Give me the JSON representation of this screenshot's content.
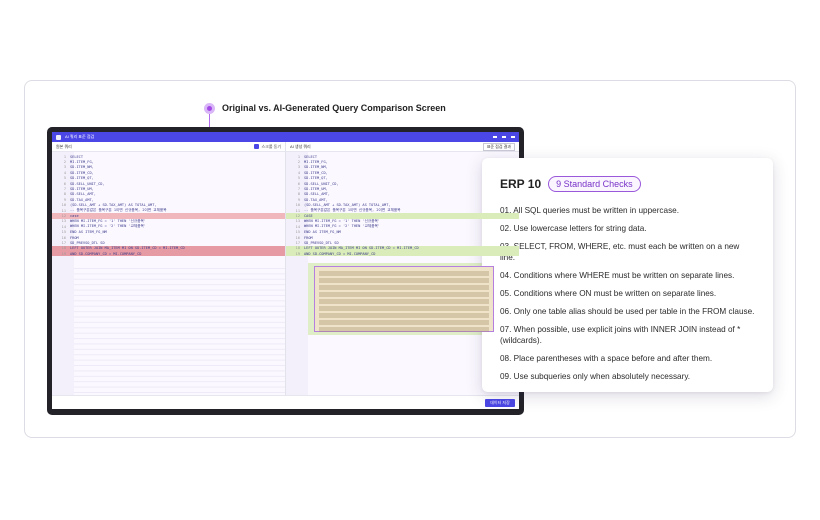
{
  "callout": {
    "label": "Original vs. AI-Generated Query Comparison Screen"
  },
  "window": {
    "title": "AI 쿼리 표준 점검",
    "footer_button": "데이터 저장"
  },
  "left_pane": {
    "header": "원본 쿼리",
    "checkbox_label": "스크롤 동기",
    "lines": [
      "SELECT",
      "  MI.ITEM_FG,",
      "  SD.ITEM_NM,",
      "  SD.ITEM_CD,",
      "  SD.ITEM_QT,",
      "  SD.SELL_UNIT_CD,",
      "  SD.ITEM_UM,",
      "  SD.SELL_AMT,",
      "  SD.TAX_AMT,",
      "  (SD.SELL_AMT + SD.TAX_AMT) AS TOTAL_AMT,",
      "  -- 품목구분값은 품목구분 1이면 신규품목, 2이면 교체품목",
      "  case",
      "    WHEN MI.ITEM_FG = '1' THEN '신규품목'",
      "    WHEN MI.ITEM_FG = '2' THEN '교체품목'",
      "  END AS ITEM_FG_NM",
      "FROM",
      "  SD_PREVSO_DTL SD",
      "  LEFT OUTER JOIN MA_ITEM MI ON SD.ITEM_CD = MI.ITEM_CD",
      "  AND SD.COMPANY_CD = MI.COMPANY_CD"
    ]
  },
  "right_pane": {
    "header": "AI 생성 쿼리",
    "button": "표준 점검 결과",
    "lines": [
      "SELECT",
      "  MI.ITEM_FG,",
      "  SD.ITEM_NM,",
      "  SD.ITEM_CD,",
      "  SD.ITEM_QT,",
      "  SD.SELL_UNIT_CD,",
      "  SD.ITEM_UM,",
      "  SD.SELL_AMT,",
      "  SD.TAX_AMT,",
      "  (SD.SELL_AMT + SD.TAX_AMT) AS TOTAL_AMT,",
      "  -- 품목구분값은 품목구분 1이면 신규품목, 2이면 교체품목",
      "  CASE",
      "    WHEN MI.ITEM_FG = '1' THEN '신규품목'",
      "    WHEN MI.ITEM_FG = '2' THEN '교체품목'",
      "  END AS ITEM_FG_NM",
      "FROM",
      "  SD_PREVSO_DTL SD",
      "  LEFT OUTER JOIN MA_ITEM MI ON SD.ITEM_CD = MI.ITEM_CD",
      "  AND SD.COMPANY_CD = MI.COMPANY_CD"
    ]
  },
  "card": {
    "title": "ERP 10",
    "pill": "9 Standard Checks",
    "items": [
      "01. All SQL queries must be written in uppercase.",
      "02. Use lowercase letters for string data.",
      "03. SELECT, FROM, WHERE, etc. must each be written on a new line.",
      "04. Conditions where WHERE must be written on separate lines.",
      "05. Conditions where ON must be written on separate lines.",
      "06. Only one table alias should be used per table in the FROM clause.",
      "07. When possible, use explicit joins with INNER JOIN instead of * (wildcards).",
      "08. Place parentheses with a space before and after them.",
      "09. Use subqueries only when absolutely necessary."
    ]
  }
}
